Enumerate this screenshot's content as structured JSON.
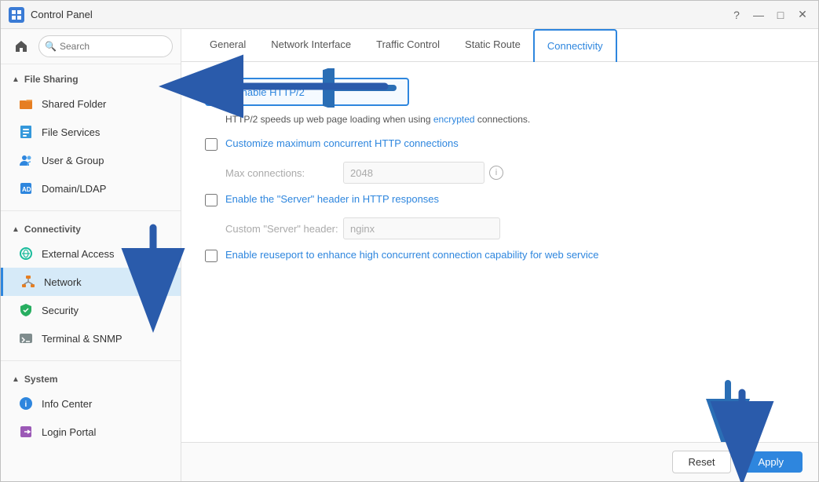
{
  "window": {
    "title": "Control Panel",
    "controls": [
      "?",
      "—",
      "□",
      "✕"
    ]
  },
  "sidebar": {
    "search_placeholder": "Search",
    "sections": [
      {
        "id": "file-sharing",
        "label": "File Sharing",
        "expanded": true,
        "items": [
          {
            "id": "shared-folder",
            "label": "Shared Folder",
            "icon": "folder-icon",
            "icon_color": "#e67e22",
            "active": false
          },
          {
            "id": "file-services",
            "label": "File Services",
            "icon": "file-services-icon",
            "icon_color": "#3498db",
            "active": false
          },
          {
            "id": "user-group",
            "label": "User & Group",
            "icon": "user-group-icon",
            "icon_color": "#2e86de",
            "active": false
          },
          {
            "id": "domain-ldap",
            "label": "Domain/LDAP",
            "icon": "domain-icon",
            "icon_color": "#2e86de",
            "active": false
          }
        ]
      },
      {
        "id": "connectivity",
        "label": "Connectivity",
        "expanded": true,
        "items": [
          {
            "id": "external-access",
            "label": "External Access",
            "icon": "external-access-icon",
            "icon_color": "#1abc9c",
            "active": false
          },
          {
            "id": "network",
            "label": "Network",
            "icon": "network-icon",
            "icon_color": "#e67e22",
            "active": true
          },
          {
            "id": "security",
            "label": "Security",
            "icon": "security-icon",
            "icon_color": "#27ae60",
            "active": false
          },
          {
            "id": "terminal-snmp",
            "label": "Terminal & SNMP",
            "icon": "terminal-icon",
            "icon_color": "#7f8c8d",
            "active": false
          }
        ]
      },
      {
        "id": "system",
        "label": "System",
        "expanded": true,
        "items": [
          {
            "id": "info-center",
            "label": "Info Center",
            "icon": "info-icon",
            "icon_color": "#2e86de",
            "active": false
          },
          {
            "id": "login-portal",
            "label": "Login Portal",
            "icon": "login-icon",
            "icon_color": "#9b59b6",
            "active": false
          }
        ]
      }
    ]
  },
  "tabs": [
    {
      "id": "general",
      "label": "General",
      "active": false
    },
    {
      "id": "network-interface",
      "label": "Network Interface",
      "active": false
    },
    {
      "id": "traffic-control",
      "label": "Traffic Control",
      "active": false
    },
    {
      "id": "static-route",
      "label": "Static Route",
      "active": false
    },
    {
      "id": "connectivity",
      "label": "Connectivity",
      "active": true
    }
  ],
  "panel": {
    "option1": {
      "checked": true,
      "label": "Enable HTTP/2",
      "description": "HTTP/2 speeds up web page loading when using encrypted connections."
    },
    "option2": {
      "checked": false,
      "label": "Customize maximum concurrent HTTP connections",
      "sub_label": "Max connections:",
      "sub_value": "2048",
      "sub_info": "ℹ"
    },
    "option3": {
      "checked": false,
      "label": "Enable the \"Server\" header in HTTP responses",
      "sub_label": "Custom \"Server\" header:",
      "sub_value": "nginx"
    },
    "option4": {
      "checked": false,
      "label": "Enable reuseport to enhance high concurrent connection capability for web service"
    }
  },
  "footer": {
    "reset_label": "Reset",
    "apply_label": "Apply"
  }
}
